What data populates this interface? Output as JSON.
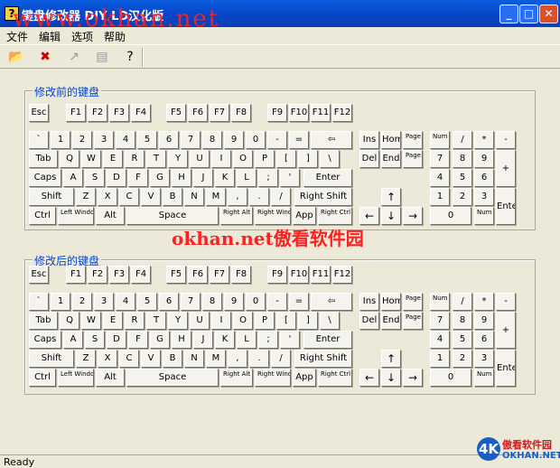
{
  "window": {
    "title": "键盘修改器  DIY  LD汉化版",
    "app_icon": "?",
    "watermark_url": "www.okhan.net",
    "minimize_icon": "minimize-icon",
    "maximize_icon": "maximize-icon",
    "close_icon": "close-icon"
  },
  "menu": [
    "文件",
    "编辑",
    "选项",
    "帮助"
  ],
  "toolbar": {
    "buttons": [
      "open-icon",
      "delete-icon",
      "apply-icon",
      "page-icon",
      "help-icon"
    ]
  },
  "groups": {
    "before_title": "修改前的键盘",
    "after_title": "修改后的键盘"
  },
  "watermark_center": "okhan.net傲看软件园",
  "status": "Ready",
  "logo": {
    "mark": "4K",
    "cn": "傲看软件园",
    "en": "OKHAN.NET"
  },
  "keys": {
    "esc": "Esc",
    "f": [
      "F1",
      "F2",
      "F3",
      "F4",
      "F5",
      "F6",
      "F7",
      "F8",
      "F9",
      "F10",
      "F11",
      "F12"
    ],
    "row1": [
      "`",
      "1",
      "2",
      "3",
      "4",
      "5",
      "6",
      "7",
      "8",
      "9",
      "0",
      "-",
      "="
    ],
    "backspace": "⇦",
    "tab": "Tab",
    "row2": [
      "Q",
      "W",
      "E",
      "R",
      "T",
      "Y",
      "U",
      "I",
      "O",
      "P",
      "[",
      "]",
      "\\"
    ],
    "caps": "Caps",
    "row3": [
      "A",
      "S",
      "D",
      "F",
      "G",
      "H",
      "J",
      "K",
      "L",
      ";",
      "'"
    ],
    "enter": "Enter",
    "shift": "Shift",
    "row4": [
      "Z",
      "X",
      "C",
      "V",
      "B",
      "N",
      "M",
      ",",
      ".",
      "/"
    ],
    "rshift": "Right Shift",
    "ctrl": "Ctrl",
    "lwin": "Left Windows",
    "alt": "Alt",
    "space": "Space",
    "ralt": "Right Alt",
    "rwin": "Right Windows",
    "app": "App",
    "rctrl": "Right Ctrl",
    "ins": "Ins",
    "home": "Home",
    "pgup": "Page Up",
    "del": "Del",
    "end": "End",
    "pgdn": "Page Down",
    "up": "↑",
    "left": "←",
    "down": "↓",
    "right": "→",
    "numlock": "Num Lock",
    "ndiv": "/",
    "nmul": "*",
    "nsub": "-",
    "n7": "7",
    "n8": "8",
    "n9": "9",
    "nadd": "+",
    "n4": "4",
    "n5": "5",
    "n6": "6",
    "n1": "1",
    "n2": "2",
    "n3": "3",
    "nenter": "Enter",
    "n0": "0",
    "ndel": "Num Del"
  }
}
